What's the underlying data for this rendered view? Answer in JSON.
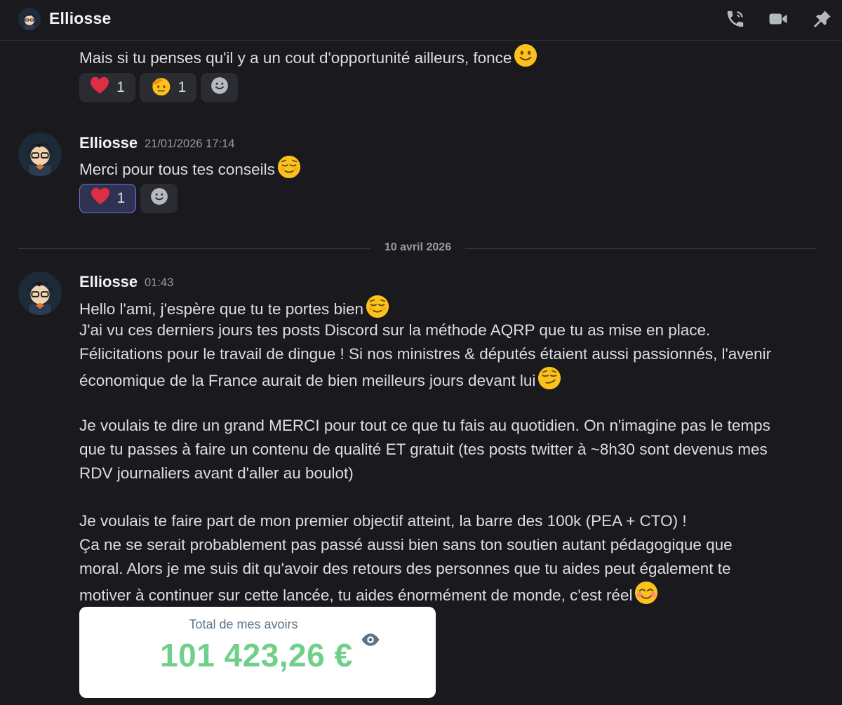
{
  "header": {
    "title": "Elliosse",
    "icons": [
      "phone-call-icon",
      "video-camera-icon",
      "pin-icon"
    ]
  },
  "previous_message": {
    "text": "Mais si tu penses qu'il y a un cout d'opportunité ailleurs, fonce",
    "emoji": "slightly-smiling-face-emoji",
    "reactions": [
      {
        "emoji": "red-heart-emoji",
        "count": "1"
      },
      {
        "emoji": "saluting-face-emoji",
        "count": "1"
      }
    ]
  },
  "message_1": {
    "author": "Elliosse",
    "timestamp": "21/01/2026 17:14",
    "text": "Merci pour tous tes conseils",
    "emoji": "relieved-face-emoji",
    "reactions": [
      {
        "emoji": "red-heart-emoji",
        "count": "1",
        "active": true
      }
    ]
  },
  "divider": {
    "label": "10 avril 2026"
  },
  "message_2": {
    "author": "Elliosse",
    "timestamp": "01:43",
    "lines": [
      "Hello l'ami, j'espère que tu te portes bien",
      "J'ai vu ces derniers jours tes posts Discord sur la méthode AQRP que tu as mise en place.",
      "Félicitations pour le travail de dingue ! Si nos ministres & députés étaient aussi passionnés, l'avenir",
      "économique de la France aurait de bien meilleurs jours devant lui",
      "Je voulais te dire un grand MERCI pour tout ce que tu fais au quotidien. On n'imagine pas le temps",
      "que tu passes à faire un contenu de qualité ET gratuit (tes posts twitter à ~8h30 sont devenus mes",
      "RDV journaliers avant d'aller au boulot)",
      "Je voulais te faire part de mon premier objectif atteint, la barre des 100k (PEA + CTO) !",
      "Ça ne se serait probablement pas passé aussi bien sans ton soutien autant pédagogique que",
      "moral. Alors je me suis dit qu'avoir des retours des personnes que tu aides peut également te",
      "motiver à continuer sur cette lancée, tu aides énormément de monde, c'est réel"
    ],
    "attachment": {
      "label": "Total de mes avoirs",
      "amount": "101 423,26 €"
    }
  },
  "colors": {
    "background": "#1a1a1e",
    "text": "#dbdee1",
    "muted": "#949ba4",
    "reaction_active_border": "#6b73e6",
    "amount_green": "#6fd089"
  }
}
